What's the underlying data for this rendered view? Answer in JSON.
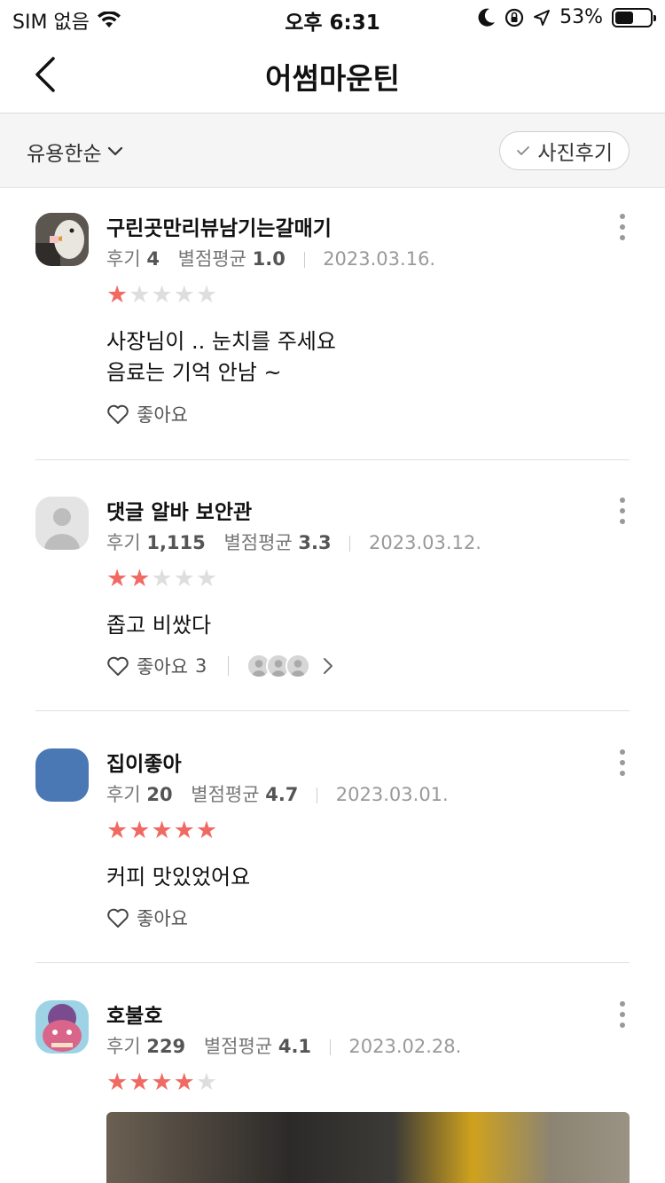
{
  "status_bar": {
    "carrier": "SIM 없음",
    "time": "오후 6:31",
    "battery": "53%",
    "battery_level": 0.53
  },
  "nav": {
    "title": "어썸마운틴"
  },
  "filter": {
    "sort_label": "유용한순",
    "photo_review_label": "사진후기"
  },
  "reviews": [
    {
      "name": "구린곳만리뷰남기는갈매기",
      "review_label": "후기",
      "review_count": "4",
      "rating_label": "별점평균",
      "rating_avg": "1.0",
      "date": "2023.03.16.",
      "stars": 1,
      "lines": [
        "사장님이 .. 눈치를 주세요",
        "음료는 기억 안남 ~"
      ],
      "like_label": "좋아요",
      "like_count": ""
    },
    {
      "name": "댓글 알바 보안관",
      "review_label": "후기",
      "review_count": "1,115",
      "rating_label": "별점평균",
      "rating_avg": "3.3",
      "date": "2023.03.12.",
      "stars": 2,
      "lines": [
        "좁고 비쌌다"
      ],
      "like_label": "좋아요",
      "like_count": "3"
    },
    {
      "name": "집이좋아",
      "review_label": "후기",
      "review_count": "20",
      "rating_label": "별점평균",
      "rating_avg": "4.7",
      "date": "2023.03.01.",
      "stars": 5,
      "lines": [
        "커피 맛있었어요"
      ],
      "like_label": "좋아요",
      "like_count": ""
    },
    {
      "name": "호불호",
      "review_label": "후기",
      "review_count": "229",
      "rating_label": "별점평균",
      "rating_avg": "4.1",
      "date": "2023.02.28.",
      "stars": 4,
      "lines": [],
      "like_label": "",
      "like_count": ""
    }
  ],
  "colors": {
    "star_on": "#f06a63",
    "star_off": "#dedede",
    "avatar_blue": "#4a78b5"
  }
}
